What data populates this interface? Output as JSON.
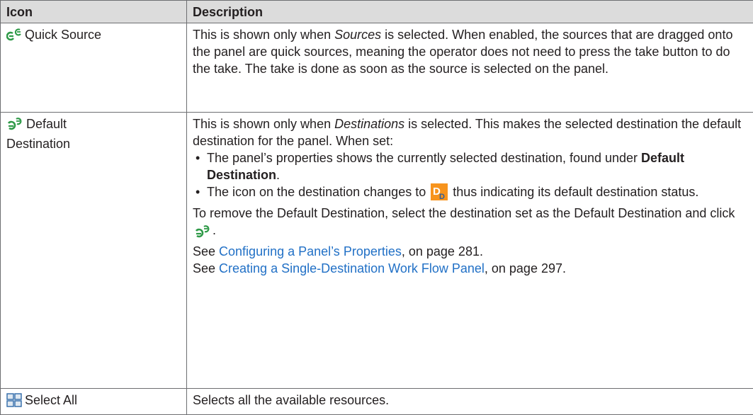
{
  "table": {
    "headers": [
      "Icon",
      "Description"
    ],
    "rows": [
      {
        "label": "Quick Source",
        "icon": "quick-source-icon",
        "desc": {
          "p1": "This is shown only when ",
          "p1_em": "Sources",
          "p1_rest": " is selected. When enabled, the sources that are dragged onto the panel are quick sources, meaning the operator does not need to press the take button to do the take. The take is done as soon as the source is selected on the panel."
        }
      },
      {
        "label_l1": "Default",
        "label_l2": "Destination",
        "icon": "default-destination-icon",
        "desc": {
          "p1": "This is shown only when ",
          "p1_em": "Destinations",
          "p1_rest": " is selected. This makes the selected destination the default destination for the panel. When set:",
          "b1": "The panel’s properties shows the currently selected destination, found under ",
          "b1_strong": "Default Destination",
          "b1_end": ".",
          "b2_pre": "The icon on the destination changes to ",
          "b2_icon": "dd-badge-icon",
          "b2_post": " thus indicating its default destination status.",
          "p2_pre": "To remove the Default Destination, select the destination set as the Default Destination and click ",
          "p2_end": ".",
          "see1_pre": "See ",
          "see1_link": "Configuring a Panel’s Properties",
          "see1_post": ", on page 281.",
          "see2_pre": "See ",
          "see2_link": "Creating a Single-Destination Work Flow Panel",
          "see2_post": ", on page 297."
        }
      },
      {
        "label": "Select All",
        "icon": "select-all-grid-icon",
        "desc": {
          "p1": "Selects all the available resources."
        }
      }
    ]
  },
  "colors": {
    "header_bg": "#dcdcdc",
    "link": "#2170c6",
    "badge": "#f7941d"
  }
}
